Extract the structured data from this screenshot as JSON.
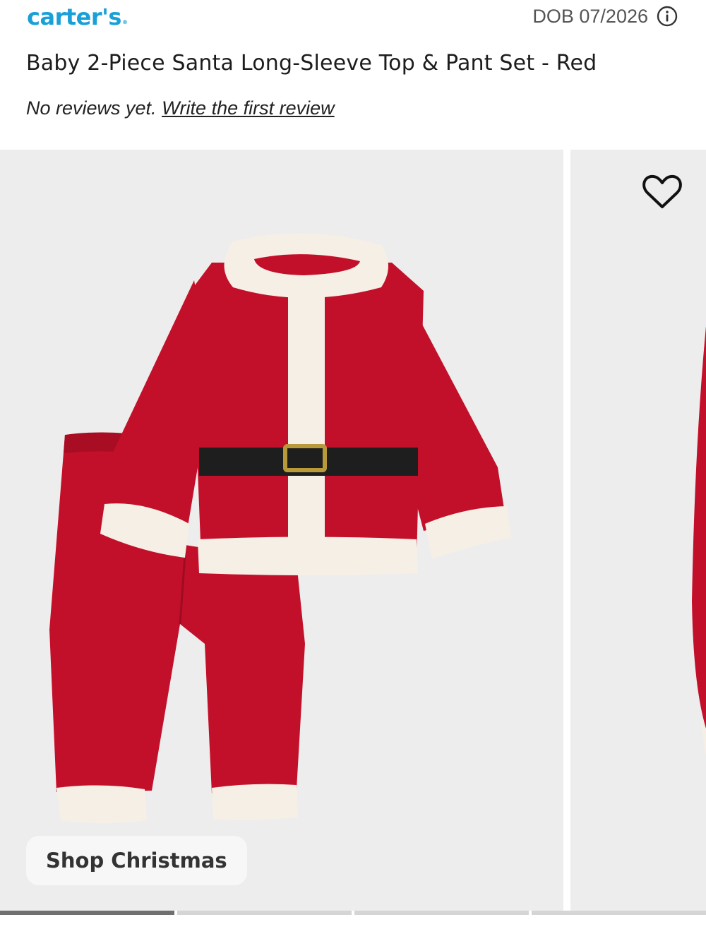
{
  "brand": {
    "logo_text": "carter's",
    "logo_mark": "®",
    "color": "#1aa0d8"
  },
  "header": {
    "dob_label": "DOB 07/2026",
    "info_icon": "info-circle-icon"
  },
  "product": {
    "title": "Baby 2-Piece Santa Long-Sleeve Top & Pant Set - Red",
    "reviews_text": "No reviews yet.",
    "review_link": "Write the first review"
  },
  "gallery": {
    "wishlist_icon": "heart-outline-icon",
    "shop_button": "Shop Christmas",
    "slide_count": 4,
    "active_slide": 1,
    "colors": {
      "background": "#ededed",
      "garment_red": "#c3102a",
      "fur": "#f6efe6",
      "belt": "#1e1e1e",
      "buckle": "#b89a3a"
    }
  }
}
